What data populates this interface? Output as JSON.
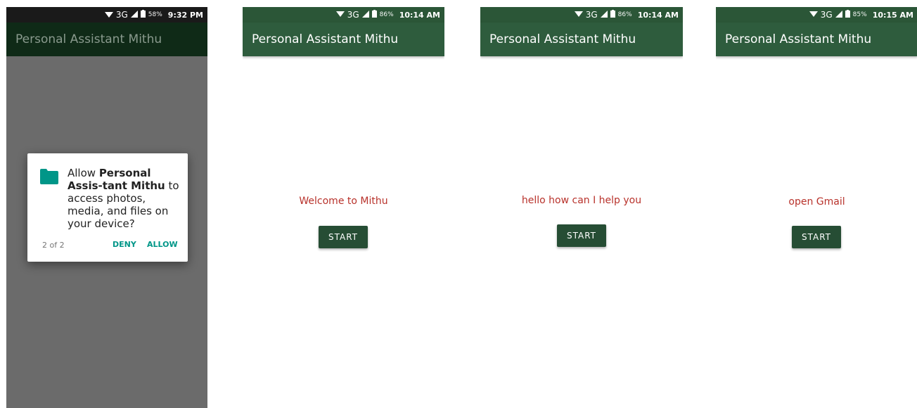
{
  "colors": {
    "dim_overlay": "#6b6b6b",
    "dim_statusbar": "#1a1a1a",
    "dim_appbar": "#0f2a17",
    "statusbar": "#2b5637",
    "appbar": "#2e5c3d",
    "accent_text": "#b8322b",
    "button": "#264d34",
    "dialog_accent": "#009688"
  },
  "screens": [
    {
      "statusbar": {
        "network": "3G",
        "battery": "58%",
        "time": "9:32 PM"
      },
      "app_title": "Personal Assistant Mithu",
      "dialog": {
        "icon": "folder-icon",
        "text_prefix": "Allow ",
        "app_name": "Personal Assis-tant Mithu",
        "text_suffix": " to access photos, media, and files on your device?",
        "counter": "2 of 2",
        "deny_label": "DENY",
        "allow_label": "ALLOW"
      }
    },
    {
      "statusbar": {
        "network": "3G",
        "battery": "86%",
        "time": "10:14 AM"
      },
      "app_title": "Personal Assistant Mithu",
      "message": "Welcome to Mithu",
      "button_label": "START"
    },
    {
      "statusbar": {
        "network": "3G",
        "battery": "86%",
        "time": "10:14 AM"
      },
      "app_title": "Personal Assistant Mithu",
      "message": "hello how can I help you",
      "button_label": "START"
    },
    {
      "statusbar": {
        "network": "3G",
        "battery": "85%",
        "time": "10:15 AM"
      },
      "app_title": "Personal Assistant Mithu",
      "message": "open Gmail",
      "button_label": "START"
    }
  ]
}
